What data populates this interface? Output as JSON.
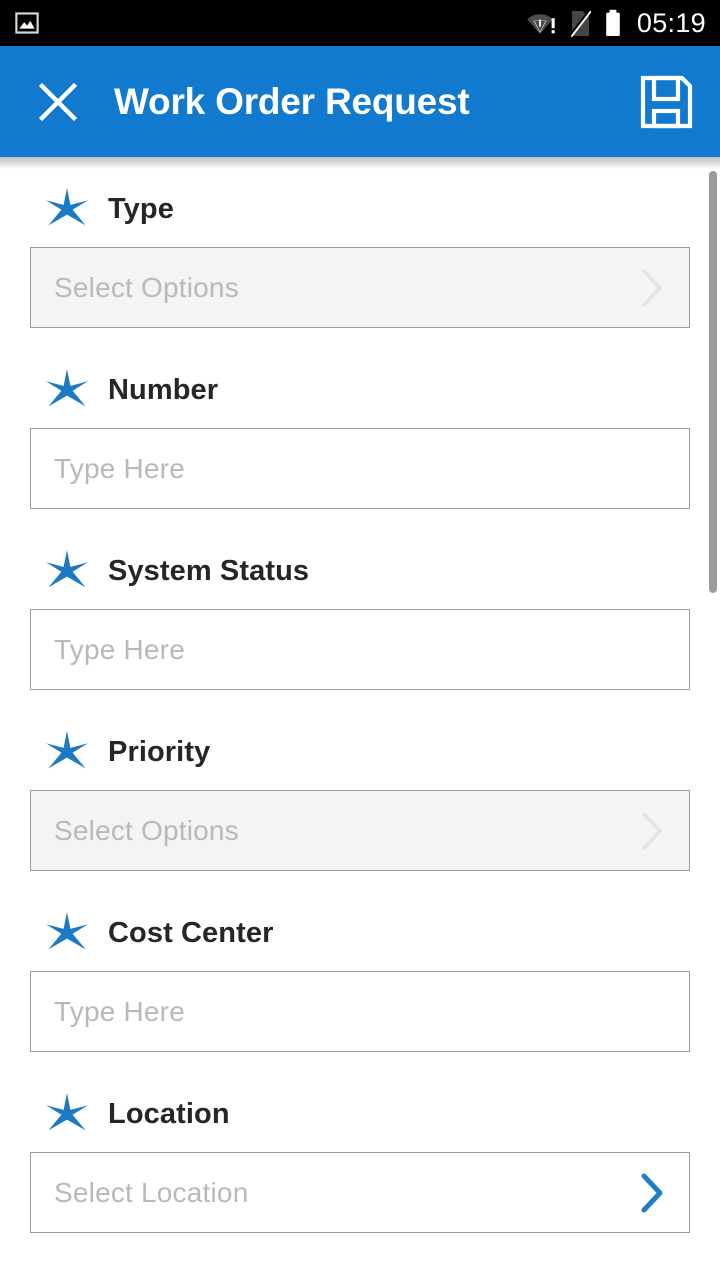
{
  "status_bar": {
    "notification_icon": "image-icon",
    "wifi_icon": "wifi-alert-icon",
    "sim_icon": "sim-card-off-icon",
    "battery_icon": "battery-full-icon",
    "clock": "05:19"
  },
  "app_bar": {
    "close_label": "close-icon",
    "title": "Work Order Request",
    "save_label": "save-icon",
    "background_color": "#1179ce"
  },
  "theme": {
    "accent": "#1179ce",
    "star_color": "#1c7ac4",
    "chevron_active": "#1f7fc4",
    "chevron_muted": "#e2e2e2",
    "field_border": "#9d9d9d",
    "field_muted_bg": "#f4f4f4",
    "placeholder_color": "#b9b9b9",
    "label_color": "#262626"
  },
  "form": {
    "fields": [
      {
        "label": "Type",
        "required": true,
        "control": "select",
        "state": "muted",
        "placeholder": "Select Options",
        "chevron": "chevron-right-icon"
      },
      {
        "label": "Number",
        "required": true,
        "control": "text",
        "state": "active",
        "placeholder": "Type Here",
        "chevron": ""
      },
      {
        "label": "System Status",
        "required": true,
        "control": "text",
        "state": "active",
        "placeholder": "Type Here",
        "chevron": ""
      },
      {
        "label": "Priority",
        "required": true,
        "control": "select",
        "state": "muted",
        "placeholder": "Select Options",
        "chevron": "chevron-right-icon"
      },
      {
        "label": "Cost Center",
        "required": true,
        "control": "text",
        "state": "active",
        "placeholder": "Type Here",
        "chevron": ""
      },
      {
        "label": "Location",
        "required": true,
        "control": "picker",
        "state": "active",
        "placeholder": "Select Location",
        "chevron": "chevron-right-icon"
      }
    ]
  },
  "scrollbar": {
    "name": "vertical-scrollbar"
  }
}
